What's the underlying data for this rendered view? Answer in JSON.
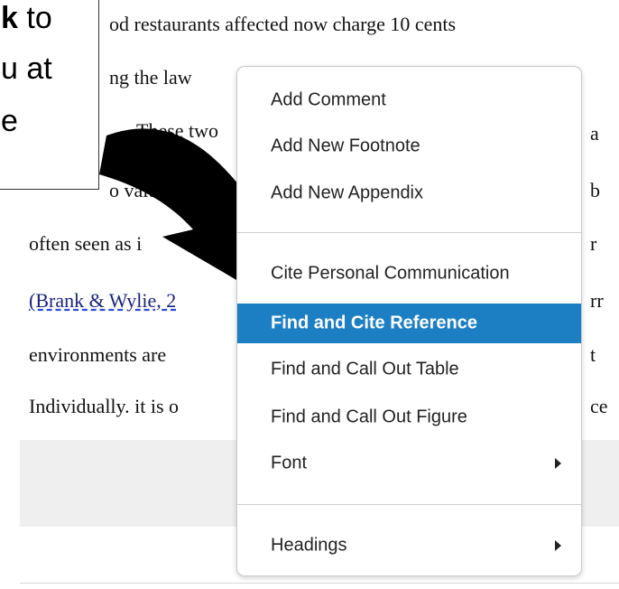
{
  "document": {
    "lines": [
      "od restaurants affected now charge 10 cents",
      "ng the law",
      "These two",
      "o valu  free",
      "often seen as i",
      "environments are",
      "Individually. it is o"
    ],
    "citation": "(Brank & Wylie, 2",
    "right_fragments": [
      "a",
      "b",
      "r",
      "rr",
      "t",
      "ce"
    ]
  },
  "callout": {
    "line1_bold": "k",
    "line1_rest": " to",
    "line2": "u at",
    "line3": "e"
  },
  "context_menu": {
    "items": [
      {
        "label": "Add Comment"
      },
      {
        "label": "Add New Footnote"
      },
      {
        "label": "Add New Appendix"
      },
      {
        "label": "Cite Personal Communication"
      },
      {
        "label": "Find and Cite Reference",
        "highlighted": true
      },
      {
        "label": "Find and Call Out Table"
      },
      {
        "label": "Find and Call Out Figure"
      },
      {
        "label": "Font",
        "submenu": true
      },
      {
        "label": "Headings",
        "submenu": true
      }
    ]
  },
  "colors": {
    "highlight": "#1c7fc4",
    "citation_underline": "#2b4fd8"
  },
  "icons": {
    "pointer": "curved-arrow-icon",
    "submenu": "chevron-right-icon"
  }
}
